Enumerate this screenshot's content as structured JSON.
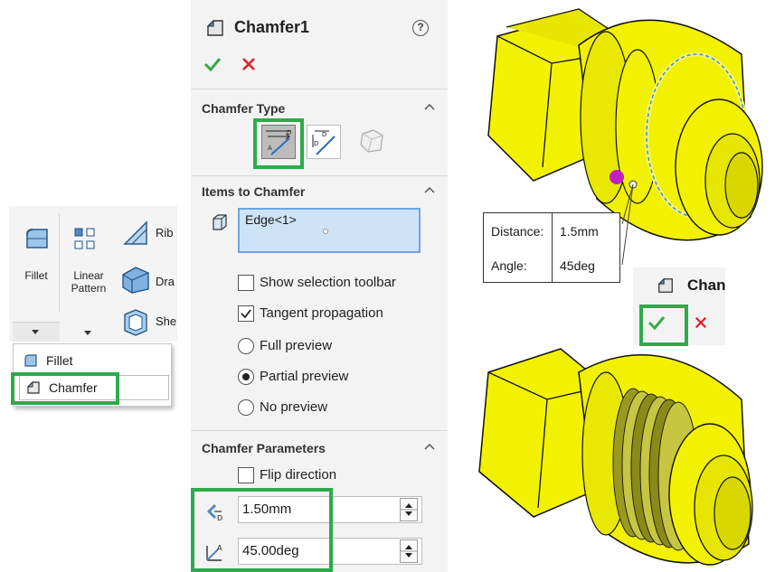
{
  "ribbon": {
    "fillet_label": "Fillet",
    "linear_pattern_label": "Linear Pattern",
    "rib_label": "Rib",
    "draft_label": "Dra",
    "shell_label": "She"
  },
  "dropdown": {
    "items": [
      {
        "label": "Fillet"
      },
      {
        "label": "Chamfer"
      }
    ]
  },
  "property_manager": {
    "title": "Chamfer1",
    "help_icon": "?",
    "chamfer_type": {
      "header": "Chamfer Type"
    },
    "items_to_chamfer": {
      "header": "Items to Chamfer",
      "selection": "Edge<1>",
      "options": [
        {
          "label": "Show selection toolbar",
          "checked": false
        },
        {
          "label": "Tangent propagation",
          "checked": true
        }
      ],
      "preview": [
        {
          "label": "Full preview",
          "selected": false
        },
        {
          "label": "Partial preview",
          "selected": true
        },
        {
          "label": "No preview",
          "selected": false
        }
      ]
    },
    "chamfer_parameters": {
      "header": "Chamfer Parameters",
      "flip_direction": "Flip direction",
      "distance_value": "1.50mm",
      "angle_value": "45.00deg"
    }
  },
  "callout": {
    "distance_label": "Distance:",
    "distance_value": "1.5mm",
    "angle_label": "Angle:",
    "angle_value": "45deg"
  },
  "mini_confirm": {
    "title": "Chan"
  },
  "colors": {
    "highlight_green": "#2eaa4a",
    "part_yellow": "#f2f200",
    "ok_green": "#3aa84a",
    "cancel_red": "#e0202a"
  }
}
